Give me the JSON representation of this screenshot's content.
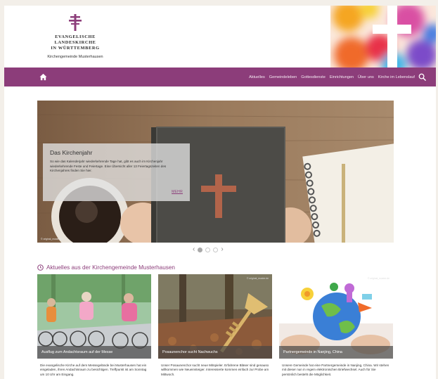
{
  "header": {
    "logo_line1": "Evangelische Landeskirche",
    "logo_line2": "in Württemberg",
    "logo_line3": "Kirchengemeinde Musterhausen"
  },
  "nav": {
    "home_icon": "home-icon",
    "items": [
      "Aktuelles",
      "Gemeindeleben",
      "Gottesdienste",
      "Einrichtungen",
      "Über uns",
      "Kirche im Lebenslauf"
    ],
    "search_icon": "search-icon",
    "accent_color": "#8c3d7a"
  },
  "slider": {
    "title": "Das Kirchenjahr",
    "text": "So wie das Kalenderjahr wiederkehrende Tage hat, gibt es auch im Kirchenjahr wiederkehrende Feste und Feiertage. Eine Übersicht aller 13 Feiertagszeiten des Kirchenjahres finden Sie hier.",
    "more": "MEHR",
    "credit": "© original_muster.de",
    "slide_count": 3,
    "active_slide": 1
  },
  "news": {
    "section_title": "Aktuelles aus der Kirchengemeinde Musterhausen",
    "cards": [
      {
        "caption": "Ausflug zum Andachtsraum auf der Messe",
        "credit": "",
        "text": "Die evangelische Kirche auf dem Messegelände bei Musterhausen hat ein eingeladen, ihren Andachtsraum zu besichtigen. Treffpunkt ist am Sonntag um 10 Uhr am Eingang."
      },
      {
        "caption": "Posaunenchor sucht Nachwuchs",
        "credit": "© original_muster.de",
        "text": "Unser Posaunenchor sucht neue Mitspieler. Erfahrene Bläser sind genauso willkommen wie Neueinsteiger. Interessierte kommen einfach zur Probe am Mittwoch."
      },
      {
        "caption": "Partnergemeinde in Nanjing, China",
        "credit": "© original_muster.de",
        "text": "Unsere Gemeinde hat eine Partnergemeinde in Nanjing, China. Wir stehen mit dieser nun in regem elektronischen Briefwechsel. Auch für Sie persönlich besteht die Möglichkeit."
      }
    ]
  }
}
